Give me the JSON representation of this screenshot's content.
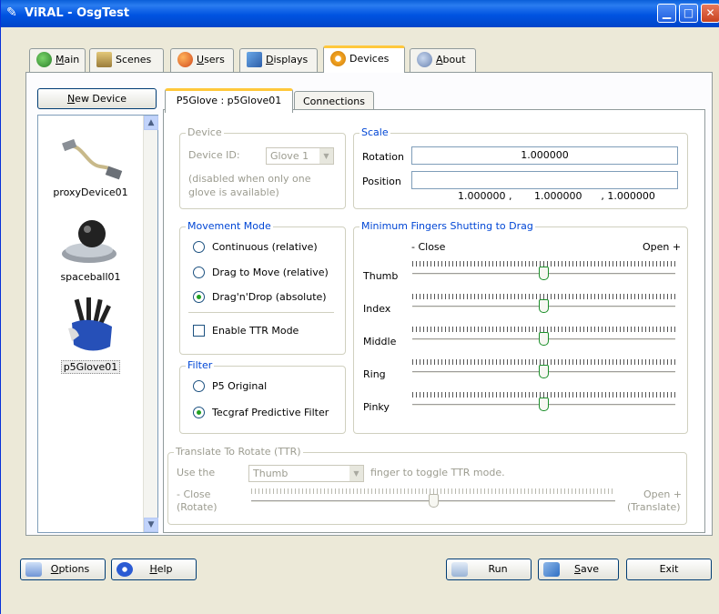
{
  "window": {
    "title": "ViRAL - OsgTest"
  },
  "main_tabs": [
    {
      "label_underline": "M",
      "label_rest": "ain"
    },
    {
      "label": "Scenes"
    },
    {
      "label_underline": "U",
      "label_rest": "sers"
    },
    {
      "label_underline": "D",
      "label_rest": "isplays"
    },
    {
      "label": "Devices"
    },
    {
      "label_underline": "A",
      "label_rest": "bout"
    }
  ],
  "new_device": {
    "label_underline": "N",
    "label_rest": "ew Device"
  },
  "devices": [
    {
      "name": "proxyDevice01",
      "icon": "cable-icon"
    },
    {
      "name": "spaceball01",
      "icon": "spaceball-icon"
    },
    {
      "name": "p5Glove01",
      "icon": "glove-icon",
      "selected": true
    }
  ],
  "sub_tabs": [
    {
      "label": "P5Glove : p5Glove01"
    },
    {
      "label": "Connections"
    }
  ],
  "device_group": {
    "legend": "Device",
    "id_label": "Device ID:",
    "id_value": "Glove 1",
    "note_line1": "(disabled when only one",
    "note_line2": "glove is available)"
  },
  "scale_group": {
    "legend": "Scale",
    "rotation_label": "Rotation",
    "rotation_value": "1.000000",
    "position_label": "Position",
    "position_value": "1.000000 ,       1.000000      , 1.000000"
  },
  "movement_group": {
    "legend": "Movement Mode",
    "options": [
      "Continuous (relative)",
      "Drag to Move (relative)",
      "Drag'n'Drop (absolute)"
    ],
    "selected_index": 2,
    "ttr_checkbox_label": "Enable TTR Mode",
    "ttr_checked": false
  },
  "filter_group": {
    "legend": "Filter",
    "options": [
      "P5 Original",
      "Tecgraf Predictive Filter"
    ],
    "selected_index": 1
  },
  "fingers_group": {
    "legend": "Minimum Fingers Shutting to Drag",
    "close_label": "- Close",
    "open_label": "Open +",
    "fingers": [
      {
        "label": "Thumb",
        "value": 0.5
      },
      {
        "label": "Index",
        "value": 0.5
      },
      {
        "label": "Middle",
        "value": 0.5
      },
      {
        "label": "Ring",
        "value": 0.5
      },
      {
        "label": "Pinky",
        "value": 0.5
      }
    ]
  },
  "ttr_group": {
    "legend": "Translate To Rotate (TTR)",
    "use_the": "Use the",
    "finger_value": "Thumb",
    "suffix": "finger to toggle TTR mode.",
    "close_line1": "- Close",
    "close_line2": "(Rotate)",
    "open_line1": "Open +",
    "open_line2": "(Translate)",
    "slider_value": 0.5
  },
  "bottom": {
    "options": {
      "label_underline": "O",
      "label_rest": "ptions"
    },
    "help": {
      "label_underline": "H",
      "label_rest": "elp"
    },
    "run": {
      "label": "Run"
    },
    "save": {
      "label_underline": "S",
      "label_rest": "ave"
    },
    "exit": {
      "label": "Exit"
    }
  }
}
